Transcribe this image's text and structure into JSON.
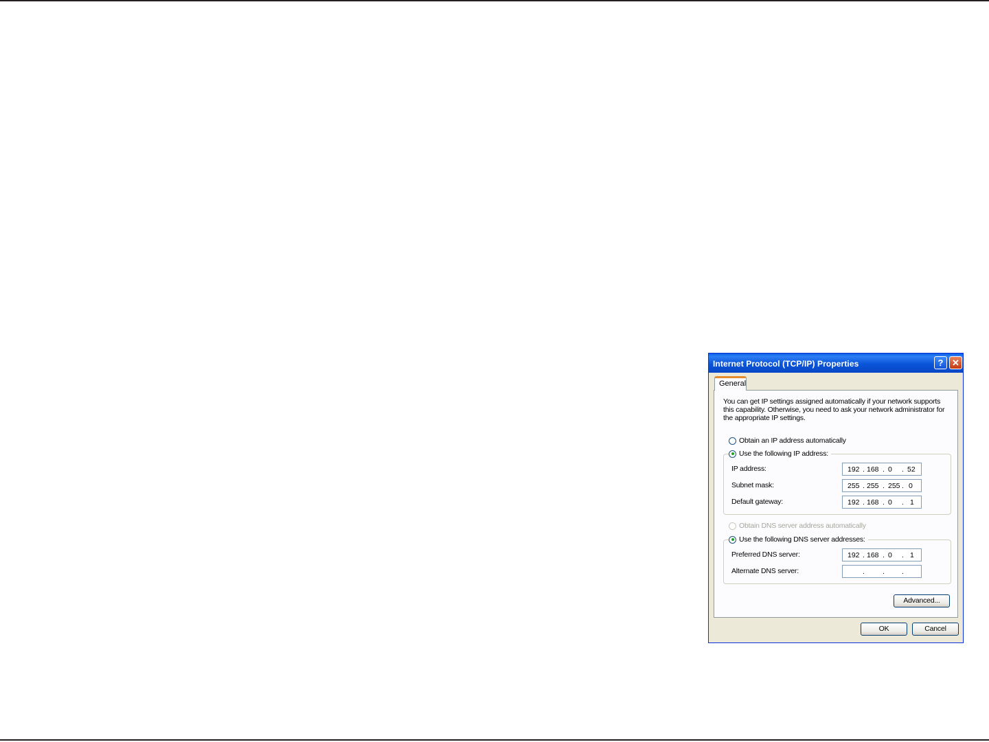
{
  "dialog": {
    "title": "Internet Protocol (TCP/IP) Properties",
    "help_glyph": "?",
    "close_glyph": "✕",
    "tab_label": "General",
    "description_lines": [
      "You can get IP settings assigned automatically if your network supports",
      "this capability. Otherwise, you need to ask your network administrator for",
      "the appropriate IP settings."
    ],
    "ip": {
      "auto_label": "Obtain an IP address automatically",
      "manual_label": "Use the following IP address:",
      "selected": "manual",
      "fields": [
        {
          "label": "IP address:",
          "octets": [
            "192",
            ".",
            "168",
            ".",
            "0",
            ".",
            "52"
          ]
        },
        {
          "label": "Subnet mask:",
          "octets": [
            "255",
            ".",
            "255",
            ".",
            "255",
            ".",
            "0"
          ]
        },
        {
          "label": "Default gateway:",
          "octets": [
            "192",
            ".",
            "168",
            ".",
            "0",
            ".",
            "1"
          ]
        }
      ]
    },
    "dns": {
      "auto_label": "Obtain DNS server address automatically",
      "manual_label": "Use the following DNS server addresses:",
      "selected": "manual",
      "fields": [
        {
          "label": "Preferred DNS server:",
          "octets": [
            "192",
            ".",
            "168",
            ".",
            "0",
            ".",
            "1"
          ]
        },
        {
          "label": "Alternate DNS server:",
          "dots": [
            ".",
            ".",
            "."
          ]
        }
      ]
    },
    "advanced_label": "Advanced...",
    "ok_label": "OK",
    "cancel_label": "Cancel"
  },
  "colors": {
    "titlebar": "#0a54d8",
    "dialog_face": "#ece9d8",
    "tab_highlight": "#e68b2c",
    "radio_selected": "#21a121"
  }
}
